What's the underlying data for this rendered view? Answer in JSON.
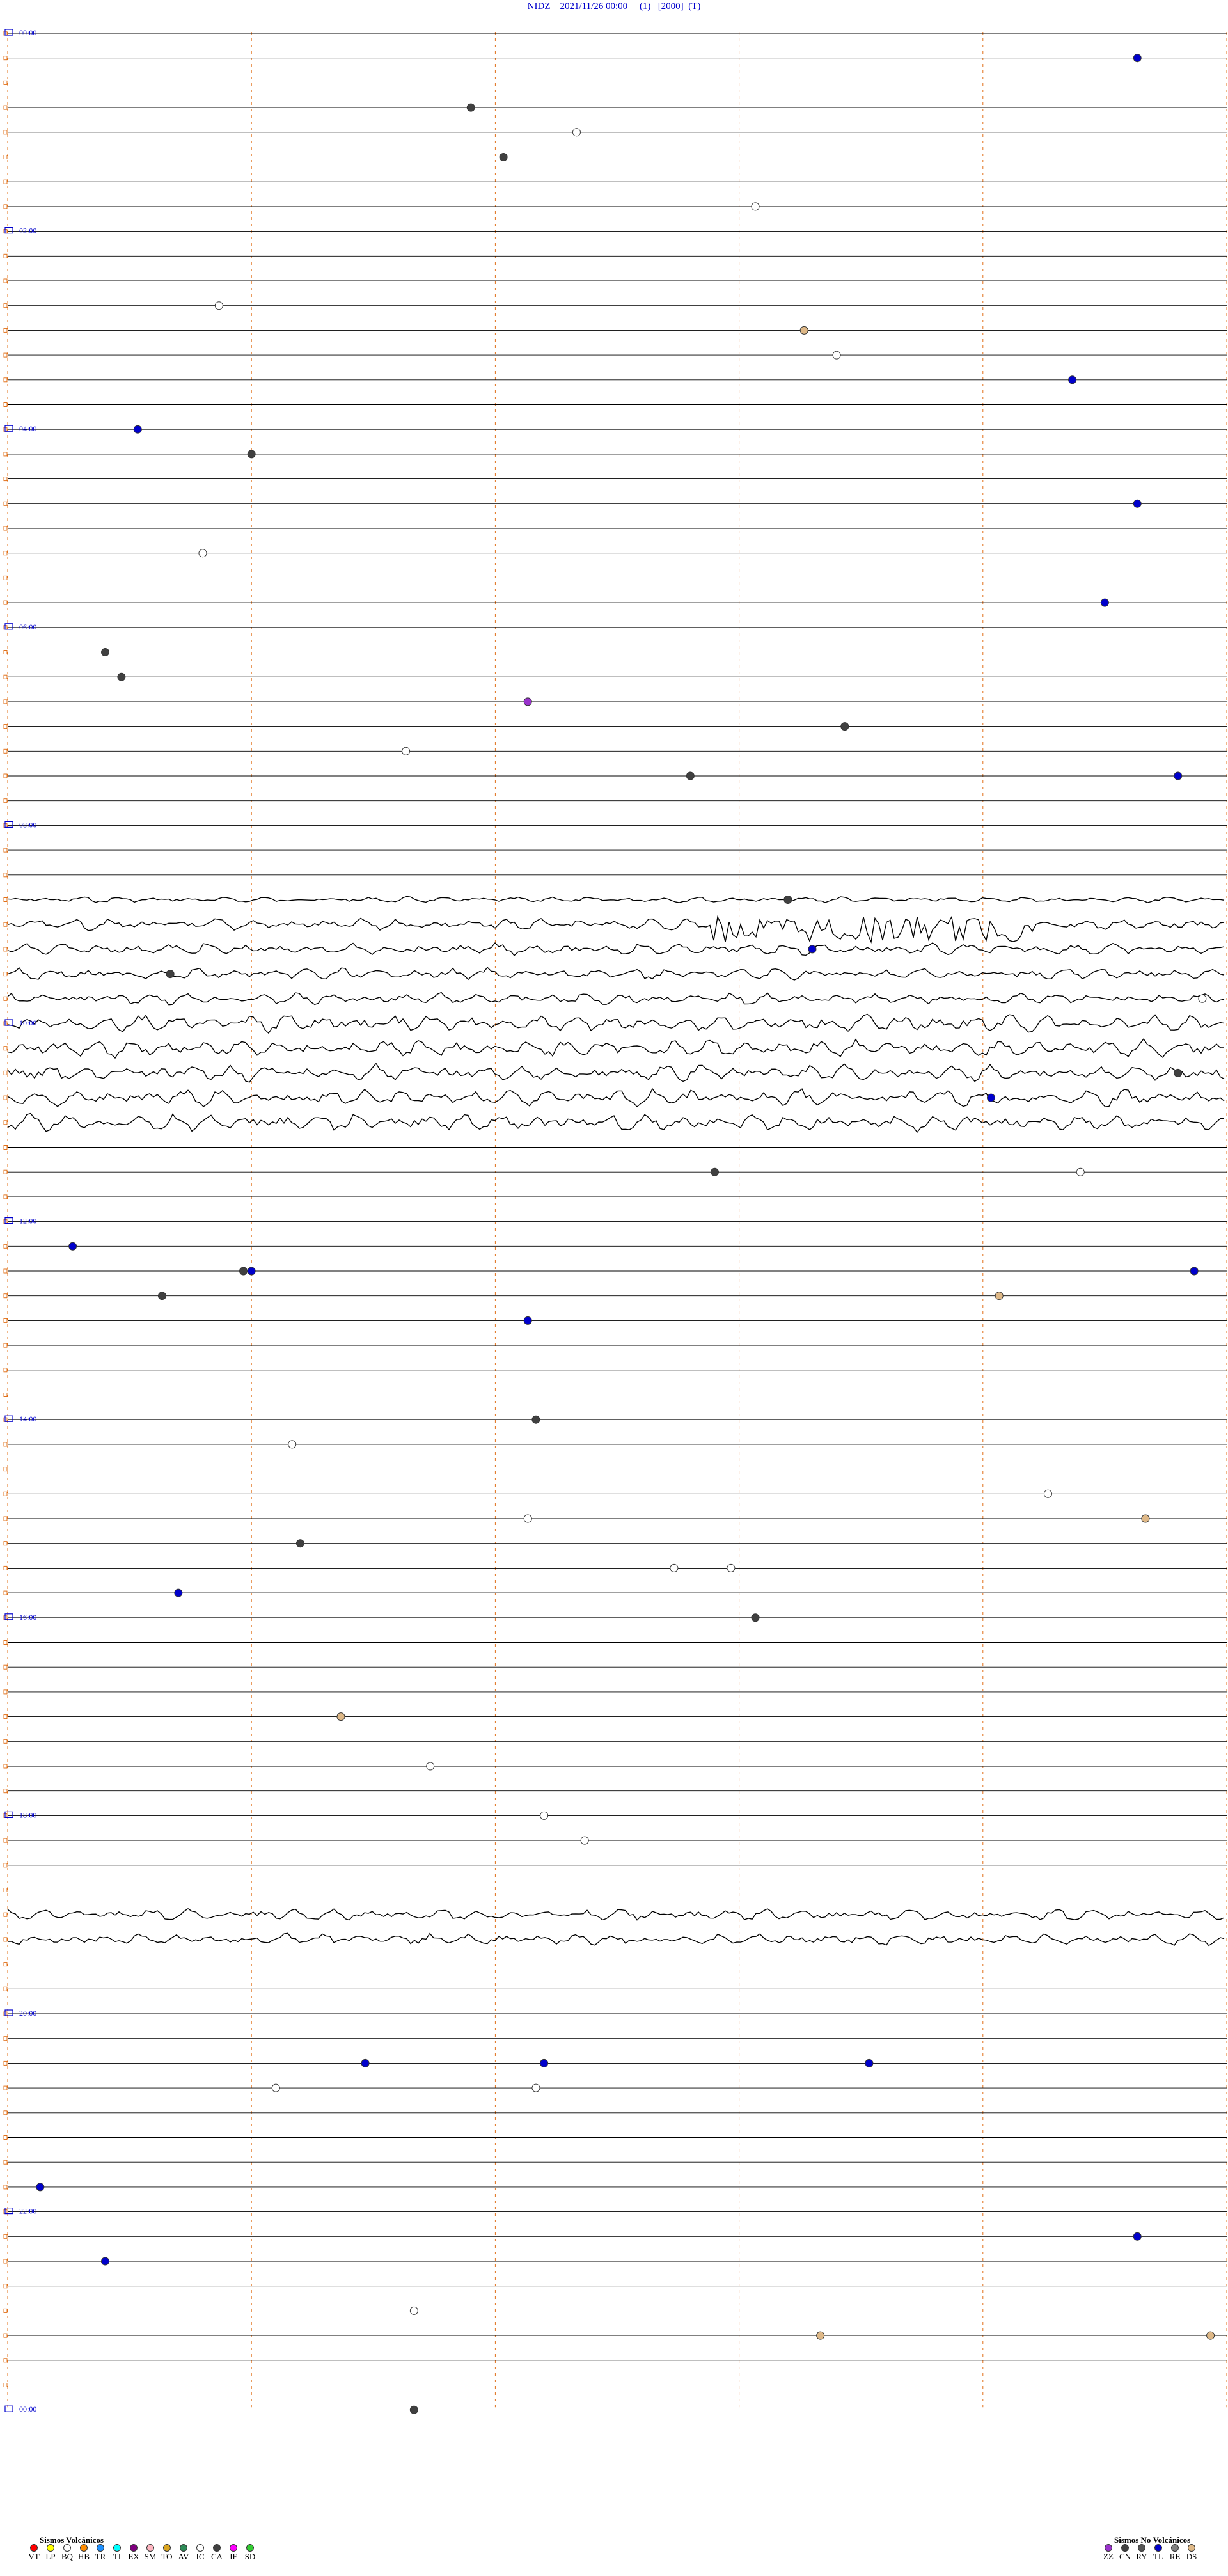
{
  "header": {
    "station": "NIDZ",
    "datetime": "2021/11/26 00:00",
    "field1": "(1)",
    "field2": "[2000]",
    "field3": "(T)"
  },
  "chart_data": {
    "type": "scatter",
    "description_kind": "helicorder",
    "rows": 96,
    "row_minutes": 15,
    "columns_minutes": [
      0,
      3,
      6,
      9,
      12,
      15
    ],
    "hour_labels": [
      "00:00",
      "02:00",
      "04:00",
      "06:00",
      "08:00",
      "10:00",
      "12:00",
      "14:00",
      "16:00",
      "18:00",
      "20:00",
      "22:00",
      "00:00"
    ],
    "colors": {
      "trace": "#000000",
      "marker_line": "#e0701a",
      "hour_label": "#0000cc",
      "VT": "#ff0000",
      "LP": "#ffff00",
      "BQ": "#ffffff",
      "HB": "#ff8c00",
      "TR": "#1e90ff",
      "TI": "#00ffff",
      "EX": "#800080",
      "SM": "#ffb6c1",
      "TO": "#daa520",
      "AV": "#2e8b57",
      "IC": "#ffffff",
      "CA": "#404040",
      "IF": "#ff00ff",
      "SD": "#32cd32",
      "ZZ": "#9932cc",
      "CN": "#404040",
      "RY": "#555555",
      "TL": "#0000cc",
      "RE": "#808080",
      "DS": "#deb887"
    },
    "noisy_rows": [
      {
        "row": 35,
        "amp": 1
      },
      {
        "row": 36,
        "amp": 2
      },
      {
        "row": 37,
        "amp": 2
      },
      {
        "row": 38,
        "amp": 2
      },
      {
        "row": 39,
        "amp": 2
      },
      {
        "row": 40,
        "amp": 3
      },
      {
        "row": 41,
        "amp": 3
      },
      {
        "row": 42,
        "amp": 3
      },
      {
        "row": 43,
        "amp": 3
      },
      {
        "row": 44,
        "amp": 3
      },
      {
        "row": 76,
        "amp": 2
      },
      {
        "row": 77,
        "amp": 2
      }
    ],
    "events": [
      {
        "row": 1,
        "minute": 13.9,
        "type": "TL"
      },
      {
        "row": 3,
        "minute": 5.7,
        "type": "CA"
      },
      {
        "row": 4,
        "minute": 7.0,
        "type": "IC"
      },
      {
        "row": 5,
        "minute": 6.1,
        "type": "CA"
      },
      {
        "row": 7,
        "minute": 9.2,
        "type": "IC"
      },
      {
        "row": 11,
        "minute": 2.6,
        "type": "IC"
      },
      {
        "row": 12,
        "minute": 9.8,
        "type": "DS"
      },
      {
        "row": 13,
        "minute": 10.2,
        "type": "IC"
      },
      {
        "row": 14,
        "minute": 13.1,
        "type": "TL"
      },
      {
        "row": 16,
        "minute": 1.6,
        "type": "TL"
      },
      {
        "row": 17,
        "minute": 3.0,
        "type": "CA"
      },
      {
        "row": 19,
        "minute": 13.9,
        "type": "TL"
      },
      {
        "row": 21,
        "minute": 2.4,
        "type": "IC"
      },
      {
        "row": 23,
        "minute": 13.5,
        "type": "TL"
      },
      {
        "row": 25,
        "minute": 1.2,
        "type": "CA"
      },
      {
        "row": 26,
        "minute": 1.4,
        "type": "CA"
      },
      {
        "row": 27,
        "minute": 6.4,
        "type": "ZZ"
      },
      {
        "row": 28,
        "minute": 10.3,
        "type": "CA"
      },
      {
        "row": 29,
        "minute": 4.9,
        "type": "IC"
      },
      {
        "row": 30,
        "minute": 14.4,
        "type": "TL"
      },
      {
        "row": 30,
        "minute": 8.4,
        "type": "CA"
      },
      {
        "row": 35,
        "minute": 9.6,
        "type": "CA"
      },
      {
        "row": 37,
        "minute": 9.9,
        "type": "TL"
      },
      {
        "row": 38,
        "minute": 2.0,
        "type": "CA"
      },
      {
        "row": 39,
        "minute": 14.7,
        "type": "IC"
      },
      {
        "row": 42,
        "minute": 14.4,
        "type": "CA"
      },
      {
        "row": 43,
        "minute": 12.1,
        "type": "TL"
      },
      {
        "row": 46,
        "minute": 8.7,
        "type": "CA"
      },
      {
        "row": 46,
        "minute": 13.2,
        "type": "IC"
      },
      {
        "row": 49,
        "minute": 0.8,
        "type": "TL"
      },
      {
        "row": 50,
        "minute": 2.9,
        "type": "CA"
      },
      {
        "row": 50,
        "minute": 3.0,
        "type": "TL"
      },
      {
        "row": 50,
        "minute": 14.6,
        "type": "TL"
      },
      {
        "row": 51,
        "minute": 1.9,
        "type": "CA"
      },
      {
        "row": 51,
        "minute": 12.2,
        "type": "DS"
      },
      {
        "row": 52,
        "minute": 6.4,
        "type": "TL"
      },
      {
        "row": 56,
        "minute": 6.5,
        "type": "CA"
      },
      {
        "row": 57,
        "minute": 3.5,
        "type": "IC"
      },
      {
        "row": 59,
        "minute": 12.8,
        "type": "IC"
      },
      {
        "row": 60,
        "minute": 14.0,
        "type": "DS"
      },
      {
        "row": 60,
        "minute": 6.4,
        "type": "IC"
      },
      {
        "row": 61,
        "minute": 3.6,
        "type": "CA"
      },
      {
        "row": 62,
        "minute": 8.2,
        "type": "IC"
      },
      {
        "row": 62,
        "minute": 8.9,
        "type": "IC"
      },
      {
        "row": 63,
        "minute": 2.1,
        "type": "TL"
      },
      {
        "row": 64,
        "minute": 9.2,
        "type": "CA"
      },
      {
        "row": 68,
        "minute": 4.1,
        "type": "DS"
      },
      {
        "row": 70,
        "minute": 5.2,
        "type": "IC"
      },
      {
        "row": 72,
        "minute": 6.6,
        "type": "IC"
      },
      {
        "row": 73,
        "minute": 7.1,
        "type": "IC"
      },
      {
        "row": 82,
        "minute": 4.4,
        "type": "TL"
      },
      {
        "row": 82,
        "minute": 6.6,
        "type": "TL"
      },
      {
        "row": 82,
        "minute": 10.6,
        "type": "TL"
      },
      {
        "row": 83,
        "minute": 3.3,
        "type": "IC"
      },
      {
        "row": 83,
        "minute": 6.5,
        "type": "IC"
      },
      {
        "row": 87,
        "minute": 0.4,
        "type": "TL"
      },
      {
        "row": 89,
        "minute": 13.9,
        "type": "TL"
      },
      {
        "row": 90,
        "minute": 1.2,
        "type": "TL"
      },
      {
        "row": 92,
        "minute": 5.0,
        "type": "IC"
      },
      {
        "row": 93,
        "minute": 14.8,
        "type": "DS"
      },
      {
        "row": 93,
        "minute": 10.0,
        "type": "DS"
      },
      {
        "row": 96,
        "minute": 5.0,
        "type": "CA"
      }
    ]
  },
  "legend_volcanic": {
    "title": "Sismos Volcánicos",
    "items": [
      {
        "code": "VT",
        "color": "#ff0000"
      },
      {
        "code": "LP",
        "color": "#ffff00"
      },
      {
        "code": "BQ",
        "color": "#ffffff"
      },
      {
        "code": "HB",
        "color": "#ff8c00"
      },
      {
        "code": "TR",
        "color": "#1e90ff"
      },
      {
        "code": "TI",
        "color": "#00ffff"
      },
      {
        "code": "EX",
        "color": "#800080"
      },
      {
        "code": "SM",
        "color": "#ffb6c1"
      },
      {
        "code": "TO",
        "color": "#daa520"
      },
      {
        "code": "AV",
        "color": "#2e8b57"
      },
      {
        "code": "IC",
        "color": "#ffffff"
      },
      {
        "code": "CA",
        "color": "#404040"
      },
      {
        "code": "IF",
        "color": "#ff00ff"
      },
      {
        "code": "SD",
        "color": "#32cd32"
      }
    ]
  },
  "legend_nonvolcanic": {
    "title": "Sismos No Volcánicos",
    "items": [
      {
        "code": "ZZ",
        "color": "#9932cc"
      },
      {
        "code": "CN",
        "color": "#404040"
      },
      {
        "code": "RY",
        "color": "#555555"
      },
      {
        "code": "TL",
        "color": "#0000cc"
      },
      {
        "code": "RE",
        "color": "#808080"
      },
      {
        "code": "DS",
        "color": "#deb887"
      }
    ]
  }
}
